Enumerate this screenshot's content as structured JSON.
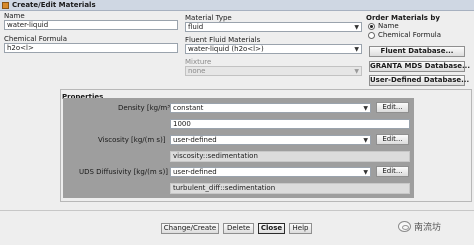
{
  "window": {
    "title": "Create/Edit Materials"
  },
  "left": {
    "name_label": "Name",
    "name_value": "water-liquid",
    "formula_label": "Chemical Formula",
    "formula_value": "h2o<l>"
  },
  "middle": {
    "material_type_label": "Material Type",
    "material_type_value": "fluid",
    "fluent_fluid_label": "Fluent Fluid Materials",
    "fluent_fluid_value": "water-liquid (h2o<l>)",
    "mixture_label": "Mixture",
    "mixture_value": "none"
  },
  "right": {
    "order_label": "Order Materials by",
    "order_options": [
      {
        "label": "Name",
        "selected": true
      },
      {
        "label": "Chemical Formula",
        "selected": false
      }
    ],
    "buttons": [
      "Fluent Database...",
      "GRANTA MDS Database...",
      "User-Defined Database..."
    ]
  },
  "properties": {
    "heading": "Properties",
    "density": {
      "label": "Density [kg/m³]",
      "method": "constant",
      "edit": "Edit...",
      "value": "1000"
    },
    "viscosity": {
      "label": "Viscosity [kg/(m s)]",
      "method": "user-defined",
      "edit": "Edit...",
      "value": "viscosity::sedimentation"
    },
    "uds": {
      "label": "UDS Diffusivity [kg/(m s)]",
      "method": "user-defined",
      "edit": "Edit...",
      "value": "turbulent_diff::sedimentation"
    }
  },
  "footer": {
    "buttons": [
      "Change/Create",
      "Delete",
      "Close",
      "Help"
    ]
  },
  "watermark": {
    "text": "南流坊"
  }
}
